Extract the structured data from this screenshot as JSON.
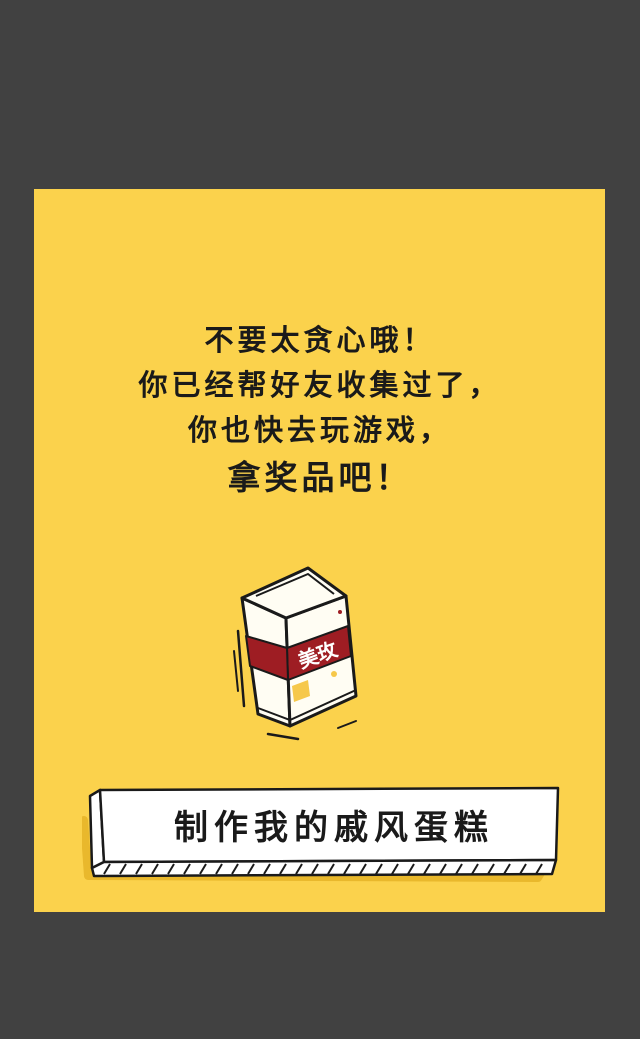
{
  "popup": {
    "message_lines": [
      "不要太贪心哦！",
      "你已经帮好友收集过了，",
      "你也快去玩游戏，",
      "拿奖品吧！"
    ],
    "prize_label": "美玫",
    "action_label": "制作我的戚风蛋糕"
  },
  "colors": {
    "overlay": "#414141",
    "card": "#fbd24c",
    "text": "#1a1a1a",
    "box_band": "#9e1d23"
  },
  "icons": {
    "prize": "cosmetic-box-icon"
  }
}
